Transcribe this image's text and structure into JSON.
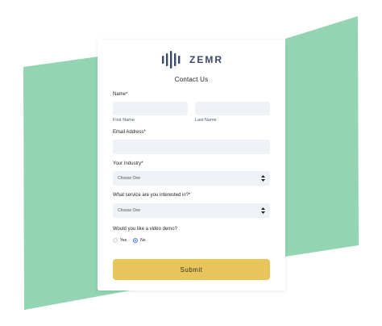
{
  "brand": {
    "name": "ZEMR",
    "logo_icon": "sound-bars-icon",
    "accent_color": "#3b4a6b"
  },
  "form": {
    "title": "Contact Us",
    "name_label": "Name*",
    "first_name_label": "First Name",
    "last_name_label": "Last Name",
    "first_name_value": "",
    "last_name_value": "",
    "email_label": "Email Address*",
    "email_value": "",
    "industry_label": "Your Industry*",
    "industry_selected": "Choose One",
    "service_label": "What service are you interested in?*",
    "service_selected": "Choose One",
    "demo_label": "Would you like a video demo?",
    "demo_options": [
      {
        "label": "Yes",
        "checked": false
      },
      {
        "label": "No",
        "checked": true
      }
    ],
    "submit_label": "Submit"
  },
  "colors": {
    "background_shape": "#93d5b2",
    "field_background": "#eef1f5",
    "submit_button": "#e8c55a",
    "radio_selected": "#4a80f0"
  }
}
